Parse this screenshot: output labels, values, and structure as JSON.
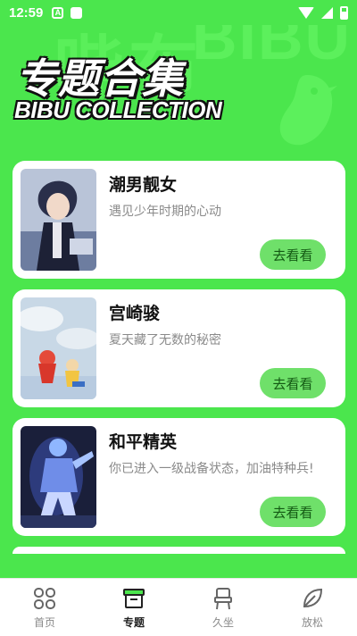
{
  "status_bar": {
    "time": "12:59",
    "icon_a": "A"
  },
  "header": {
    "title_cn": "专题合集",
    "title_en": "BIBU COLLECTION",
    "watermark_cn": "哔布",
    "watermark_en": "BIBU"
  },
  "topics": [
    {
      "title": "潮男靓女",
      "desc": "遇见少年时期的心动",
      "button": "去看看",
      "thumb": "anime-boy"
    },
    {
      "title": "宫崎骏",
      "desc": "夏天藏了无数的秘密",
      "button": "去看看",
      "thumb": "ponyo-sky"
    },
    {
      "title": "和平精英",
      "desc": "你已进入一级战备状态，加油特种兵!",
      "button": "去看看",
      "thumb": "soldier-neon"
    }
  ],
  "tabs": [
    {
      "label": "首页",
      "icon": "grid-icon",
      "active": false
    },
    {
      "label": "专题",
      "icon": "box-icon",
      "active": true
    },
    {
      "label": "久坐",
      "icon": "chair-icon",
      "active": false
    },
    {
      "label": "放松",
      "icon": "leaf-icon",
      "active": false
    }
  ],
  "colors": {
    "background": "#4be64d",
    "button": "#6fe06a",
    "button_text": "#135913"
  }
}
